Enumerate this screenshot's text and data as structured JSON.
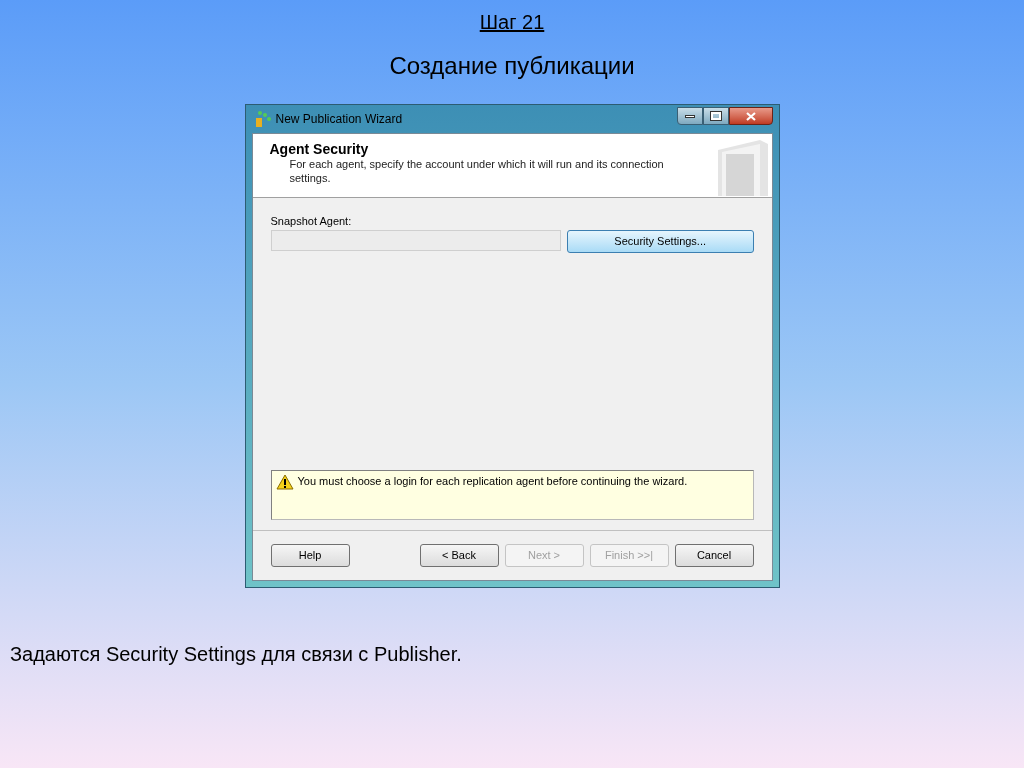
{
  "slide": {
    "step": "Шаг 21",
    "title": "Создание публикации",
    "caption": "Задаются Security Settings для связи с Publisher."
  },
  "window": {
    "title": "New Publication Wizard"
  },
  "header": {
    "title": "Agent Security",
    "description": "For each agent, specify the account under which it will run and its connection settings."
  },
  "snapshot_agent": {
    "label": "Snapshot Agent:",
    "button": {
      "label": "Security Settings...",
      "highlighted": true
    }
  },
  "message": {
    "text": "You must choose a login for each replication agent before continuing the wizard."
  },
  "buttons": [
    {
      "label": "Help",
      "disabled": false,
      "kind": "left"
    },
    {
      "label": "< Back",
      "disabled": false,
      "kind": "right"
    },
    {
      "label": "Next >",
      "disabled": true,
      "kind": "right"
    },
    {
      "label": "Finish >>|",
      "disabled": true,
      "kind": "right"
    },
    {
      "label": "Cancel",
      "disabled": false,
      "kind": "right"
    }
  ]
}
